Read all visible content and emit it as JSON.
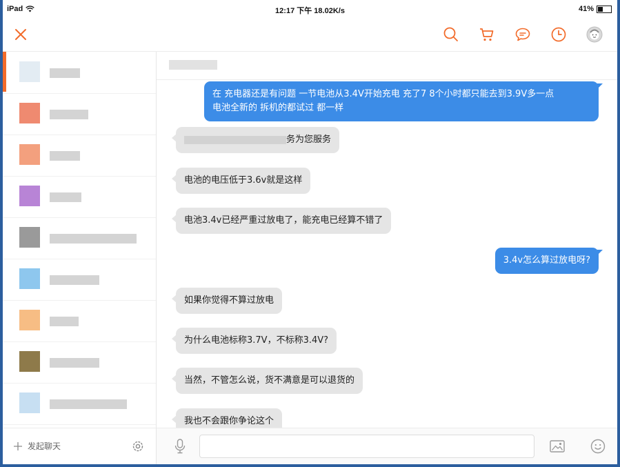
{
  "status_bar": {
    "device": "iPad",
    "time_speed": "12:17 下午 18.02K/s",
    "battery": "41%",
    "battery_level": 0.41
  },
  "top_nav": {
    "close_icon": "close-icon",
    "icons": [
      "search-icon",
      "cart-icon",
      "chat-bubble-icon",
      "clock-icon",
      "avatar-icon"
    ],
    "accent_color": "#f26b2a"
  },
  "sidebar": {
    "footer": {
      "start_chat_label": "发起聊天",
      "settings_icon": "gear-icon"
    }
  },
  "chat": {
    "messages": [
      {
        "direction": "out",
        "lines": [
          "在  充电器还是有问题  一节电池从3.4V开始充电  充了7 8个小时都只能去到3.9V多一点",
          "电池全新的 拆机的都试过 都一样"
        ]
      },
      {
        "direction": "in",
        "text": "务为您服务"
      },
      {
        "direction": "in",
        "text": "电池的电压低于3.6v就是这样"
      },
      {
        "direction": "in",
        "text": "电池3.4v已经严重过放电了，能充电已经算不错了"
      },
      {
        "direction": "out",
        "text": "3.4v怎么算过放电呀?"
      },
      {
        "direction": "in",
        "text": "如果你觉得不算过放电"
      },
      {
        "direction": "in",
        "text": "为什么电池标称3.7V，不标称3.4V?"
      },
      {
        "direction": "in",
        "text": "当然，不管怎么说，货不满意是可以退货的"
      },
      {
        "direction": "in",
        "text": "我也不会跟你争论这个"
      }
    ],
    "composer": {
      "mic_icon": "microphone-icon",
      "image_icon": "image-icon",
      "emoji_icon": "emoji-icon",
      "input_value": ""
    },
    "colors": {
      "outgoing": "#3c8ce7",
      "incoming": "#e5e5e5"
    }
  }
}
